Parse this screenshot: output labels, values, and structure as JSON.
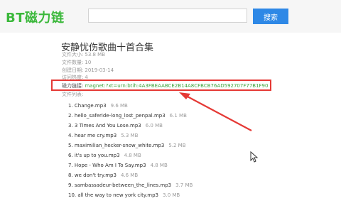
{
  "header": {
    "logo": "BT磁力链",
    "search_placeholder": "",
    "search_button": "搜索"
  },
  "torrent": {
    "title": "安静忧伤歌曲十首合集",
    "meta": [
      {
        "label": "文件大小:",
        "value": "53.8 MB"
      },
      {
        "label": "文件数量:",
        "value": "10"
      },
      {
        "label": "创建日期:",
        "value": "2019-03-14"
      },
      {
        "label": "访问热度:",
        "value": "4"
      }
    ],
    "magnet_label": "磁力链接:",
    "magnet_link": "magnet:?xt=urn:btih:4A3FBEAABCE2B14A8CFBCB76AD592707F77B1F90",
    "file_list_label": "文件列表:",
    "files": [
      {
        "name": "1. Change.mp3",
        "size": "9.6 MB"
      },
      {
        "name": "2. hello_saferide-long_lost_penpal.mp3",
        "size": "6.1 MB"
      },
      {
        "name": "3. 3 Times And You Lose.mp3",
        "size": "6.0 MB"
      },
      {
        "name": "4. hear me cry.mp3",
        "size": "5.3 MB"
      },
      {
        "name": "5. maximilian_hecker-snow_white.mp3",
        "size": "5.2 MB"
      },
      {
        "name": "6. it's up to you.mp3",
        "size": "4.8 MB"
      },
      {
        "name": "7. Hope - Who Am I To Say.mp3",
        "size": "4.8 MB"
      },
      {
        "name": "8. we don't try.mp3",
        "size": "4.6 MB"
      },
      {
        "name": "9. sambassadeur-between_the_lines.mp3",
        "size": "3.7 MB"
      },
      {
        "name": "10. all the way to new york city.mp3",
        "size": "3.0 MB"
      }
    ]
  },
  "colors": {
    "logo": "#3bb83b",
    "search_button": "#2e88e6",
    "annotation": "#e53935",
    "magnet_link": "#3ba33b"
  }
}
